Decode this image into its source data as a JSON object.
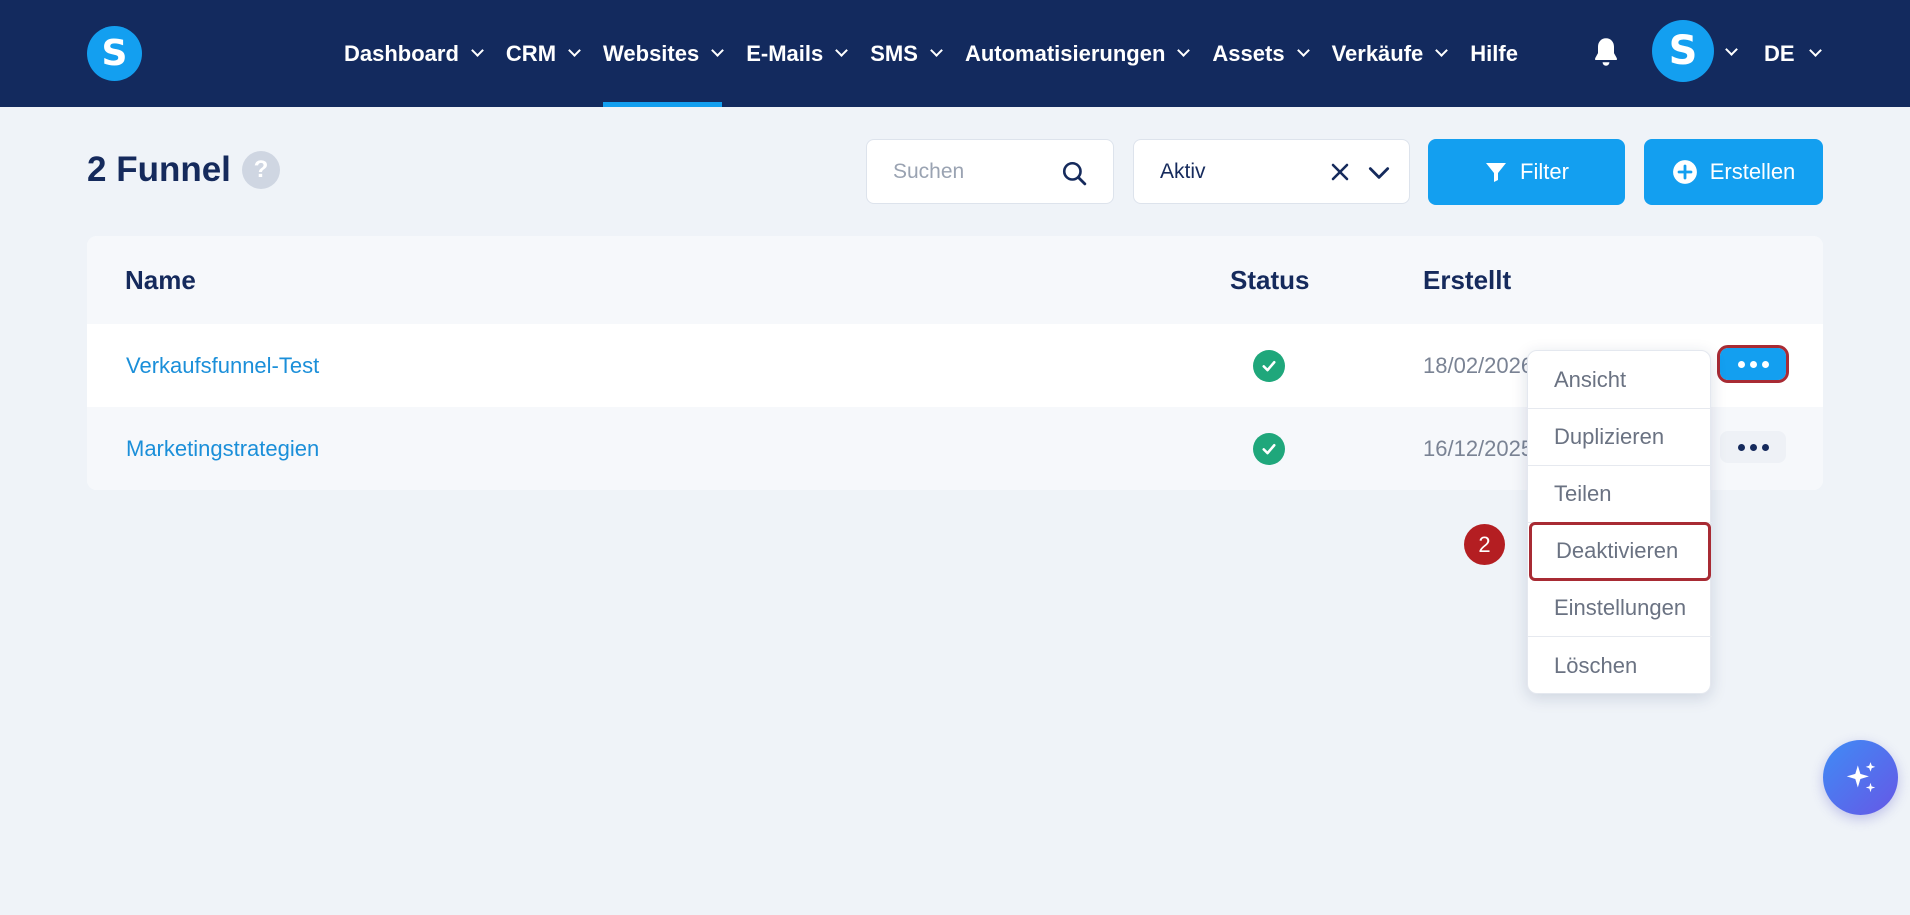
{
  "brand": {
    "logo_letter": "S"
  },
  "nav": {
    "items": [
      {
        "label": "Dashboard"
      },
      {
        "label": "CRM"
      },
      {
        "label": "Websites"
      },
      {
        "label": "E-Mails"
      },
      {
        "label": "SMS"
      },
      {
        "label": "Automatisierungen"
      },
      {
        "label": "Assets"
      },
      {
        "label": "Verkäufe"
      }
    ],
    "help_label": "Hilfe",
    "active_item": "Websites",
    "avatar_letter": "S",
    "language": "DE"
  },
  "header": {
    "title": "2 Funnel",
    "help_badge": "?",
    "search_placeholder": "Suchen",
    "status_filter_value": "Aktiv",
    "filter_button": "Filter",
    "create_button": "Erstellen"
  },
  "table": {
    "columns": {
      "name": "Name",
      "status": "Status",
      "created": "Erstellt"
    },
    "rows": [
      {
        "name": "Verkaufsfunnel-Test",
        "status": "active",
        "created": "18/02/2026"
      },
      {
        "name": "Marketingstrategien",
        "status": "active",
        "created": "16/12/2025"
      }
    ]
  },
  "action_menu": {
    "items": [
      {
        "label": "Ansicht"
      },
      {
        "label": "Duplizieren"
      },
      {
        "label": "Teilen"
      },
      {
        "label": "Deaktivieren"
      },
      {
        "label": "Einstellungen"
      },
      {
        "label": "Löschen"
      }
    ],
    "highlighted": "Deaktivieren",
    "step_number": "2"
  },
  "colors": {
    "nav_bg": "#132a5e",
    "accent": "#139ff0",
    "success": "#1fa77b",
    "highlight_border": "#a82b34",
    "page_bg": "#eff3f8"
  },
  "icons": {
    "bell": "bell-icon",
    "search": "search-icon",
    "clear": "close-icon",
    "dropdown": "chevron-down-icon",
    "filter": "funnel-icon",
    "create": "plus-circle-icon",
    "status": "check-circle-icon",
    "more": "more-horizontal-icon",
    "assistant": "sparkles-icon"
  }
}
